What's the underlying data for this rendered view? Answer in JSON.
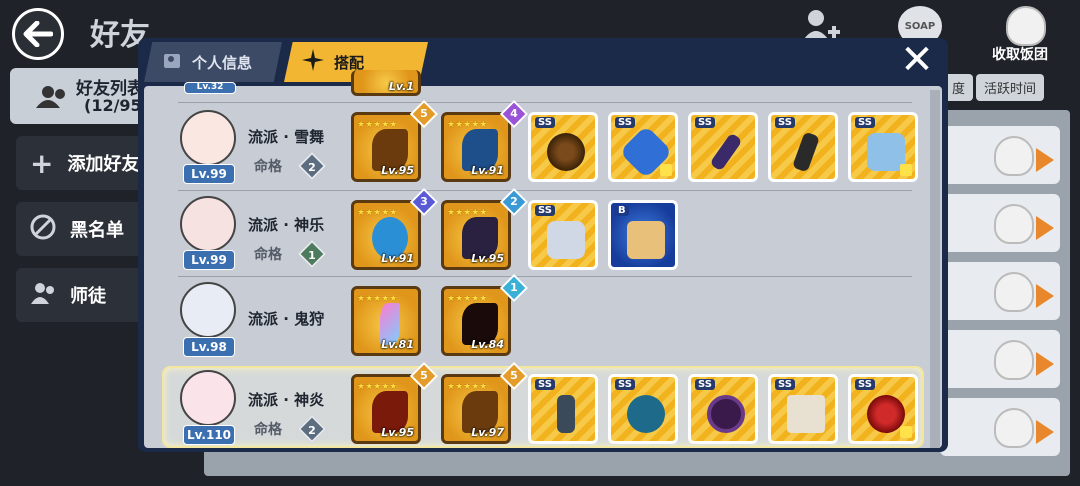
{
  "page": {
    "title": "好友",
    "top_actions": [
      {
        "label": ""
      },
      {
        "label": ""
      },
      {
        "label": "收取饭团"
      }
    ],
    "friends_list": {
      "label": "好友列表",
      "count": "(12/95"
    },
    "sidebar": [
      {
        "label": "添加好友"
      },
      {
        "label": "黑名单"
      },
      {
        "label": "师徒"
      }
    ],
    "column_headers": [
      "度",
      "活跃时间"
    ]
  },
  "modal": {
    "tabs": [
      {
        "label": "个人信息",
        "active": false
      },
      {
        "label": "搭配",
        "active": true
      }
    ],
    "close_label": "✕",
    "partial_top": {
      "lv": "Lv.32",
      "slot_lv": "Lv.1"
    },
    "rows": [
      {
        "level": "Lv.99",
        "school": "流派 · 雪舞",
        "mingge_label": "命格",
        "mingge": "2",
        "highlighted": false,
        "weapons": [
          {
            "lv": "Lv.95",
            "rank": "5",
            "rank_color": "#e39b2a"
          },
          {
            "lv": "Lv.91",
            "rank": "4",
            "rank_color": "#9a52d6"
          }
        ],
        "equips": [
          "SS",
          "SS",
          "SS",
          "SS",
          "SS"
        ]
      },
      {
        "level": "Lv.99",
        "school": "流派 · 神乐",
        "mingge_label": "命格",
        "mingge": "1",
        "highlighted": false,
        "weapons": [
          {
            "lv": "Lv.91",
            "rank": "3",
            "rank_color": "#5a5ad6"
          },
          {
            "lv": "Lv.95",
            "rank": "2",
            "rank_color": "#3a9ad6"
          }
        ],
        "equips": [
          "SS",
          "B"
        ]
      },
      {
        "level": "Lv.98",
        "school": "流派 · 鬼狩",
        "mingge_label": "",
        "mingge": "",
        "highlighted": false,
        "weapons": [
          {
            "lv": "Lv.81",
            "rank": "",
            "rank_color": ""
          },
          {
            "lv": "Lv.84",
            "rank": "1",
            "rank_color": "#3ab0d6"
          }
        ],
        "equips": []
      },
      {
        "level": "Lv.110",
        "school": "流派 · 神炎",
        "mingge_label": "命格",
        "mingge": "2",
        "highlighted": true,
        "weapons": [
          {
            "lv": "Lv.95",
            "rank": "5",
            "rank_color": "#e39b2a"
          },
          {
            "lv": "Lv.97",
            "rank": "5",
            "rank_color": "#e39b2a"
          }
        ],
        "equips": [
          "SS",
          "SS",
          "SS",
          "SS",
          "SS"
        ]
      }
    ]
  }
}
